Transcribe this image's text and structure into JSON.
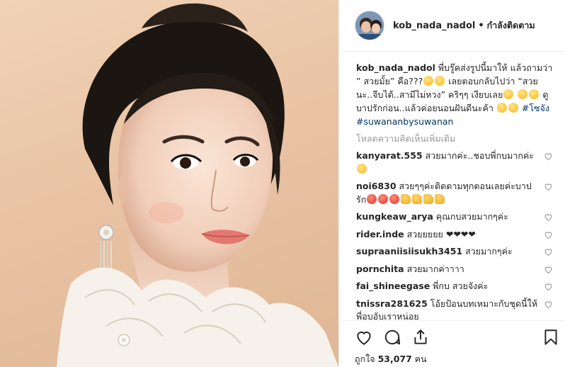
{
  "post": {
    "username": "kob_nada_nadol",
    "separator": "•",
    "follow_status": "กำลังติดตาม"
  },
  "caption": {
    "username": "kob_nada_nadol",
    "text_1": " พี่บรู๊คส่งรูปนี้มาให้ แล้วถามว่า ” สวยมั้ย” คือ???",
    "text_2": " เลยตอบกลับไปว่า “สวยนะ..จีบได้..สามีไม่หวง” คริๆๆ เงียบเลย",
    "text_3": " ดูบาปรักก่อน..แล้วค่อยนอนฝันดีนะค้า",
    "hashtag_1": "#โซจัง",
    "hashtag_2": "#suwananbysuwanan"
  },
  "load_more_comments": "โหลดความคิดเห็นเพิ่มเติม",
  "comments": [
    {
      "user": "kanyarat.555",
      "text": " สวยมากค่ะ..ชอบพี่กบมากค่ะ"
    },
    {
      "user": "noi6830",
      "text": " สวยๆๆค่ะติดตามทุกตอนเลยค่ะบาปรัก"
    },
    {
      "user": "kungkeaw_arya",
      "text": " คุณกบสวยมากๆค่ะ"
    },
    {
      "user": "rider.inde",
      "text": " สวยยยยย ❤❤❤❤"
    },
    {
      "user": "supraaniisiisukh3451",
      "text": " สวยมากๆค่ะ"
    },
    {
      "user": "pornchita",
      "text": " สวยมากค่าาาา"
    },
    {
      "user": "fai_shineegase",
      "text": " พี่กบ สวยจังค่ะ"
    },
    {
      "user": "tnissra281625",
      "text": " โอ้ยป้อนบทเหมาะกับชุดนี้ให้พี่อบอับเราหน่อย"
    }
  ],
  "likes": {
    "prefix": "ถูกใจ",
    "count": "53,077",
    "suffix": "คน"
  },
  "icons": [
    "heart-icon",
    "comment-icon",
    "share-icon",
    "bookmark-icon"
  ],
  "colors": {
    "link": "#003569",
    "muted": "#999999",
    "text": "#262626"
  }
}
